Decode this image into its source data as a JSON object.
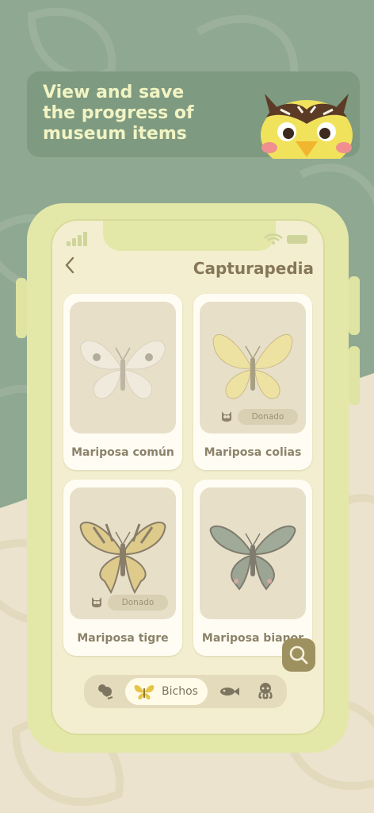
{
  "headline": "View and save\nthe progress of\nmuseum items",
  "screen": {
    "title": "Capturapedia",
    "back_icon": "chevron-left-icon"
  },
  "items": [
    {
      "name": "Mariposa común",
      "donated": false
    },
    {
      "name": "Mariposa colias",
      "donated": true,
      "badge": "Donado"
    },
    {
      "name": "Mariposa tigre",
      "donated": true,
      "badge": "Donado"
    },
    {
      "name": "Mariposa bianor",
      "donated": false
    }
  ],
  "tabs": [
    {
      "icon": "bug-leaf-icon"
    },
    {
      "icon": "butterfly-icon",
      "label": "Bichos",
      "active": true
    },
    {
      "icon": "fish-icon"
    },
    {
      "icon": "octopus-icon"
    }
  ],
  "colors": {
    "background": "#8fa891",
    "headline_text": "#f2f4c4",
    "phone_frame": "#e3e8a8",
    "screen": "#f3eecf",
    "accent": "#9e9160"
  }
}
